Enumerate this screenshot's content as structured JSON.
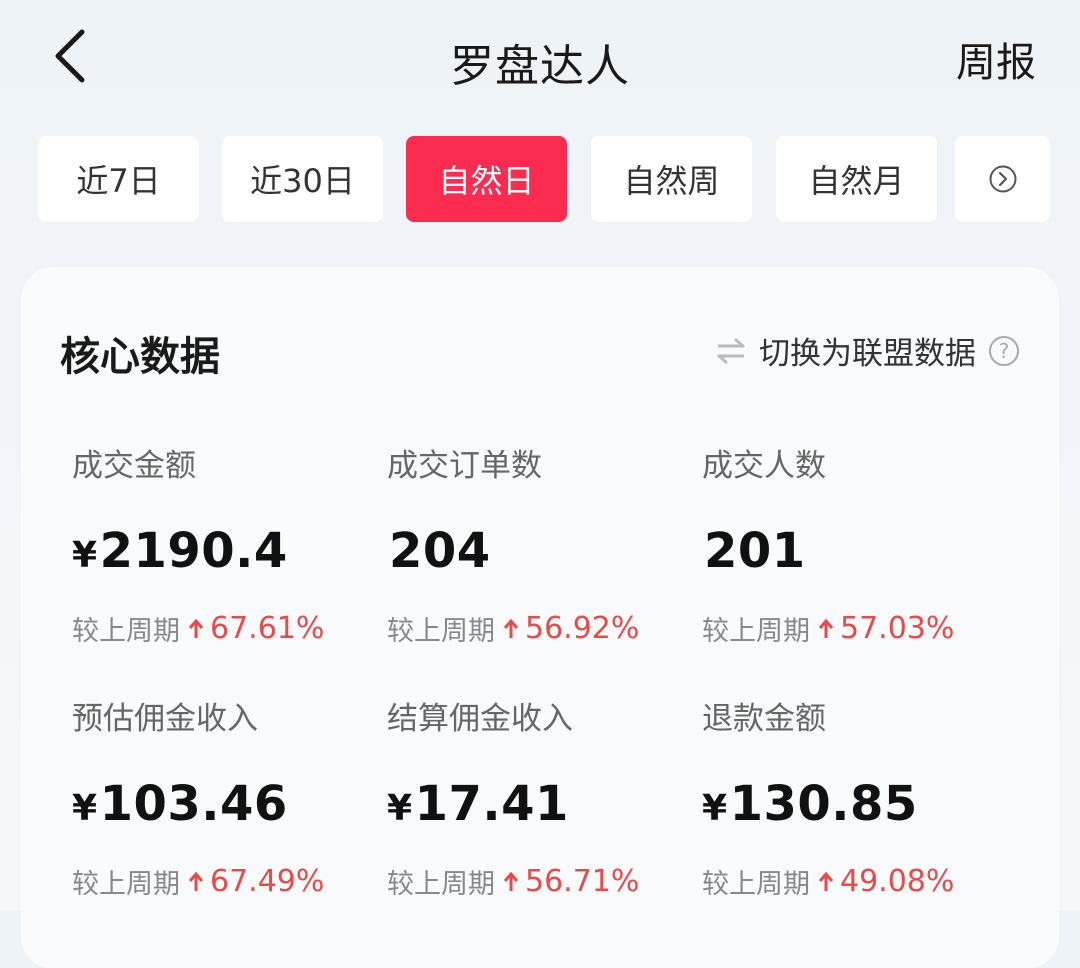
{
  "header": {
    "title": "罗盘达人",
    "right_label": "周报"
  },
  "tabs": [
    {
      "label": "近7日",
      "active": false
    },
    {
      "label": "近30日",
      "active": false
    },
    {
      "label": "自然日",
      "active": true
    },
    {
      "label": "自然周",
      "active": false
    },
    {
      "label": "自然月",
      "active": false
    }
  ],
  "colors": {
    "accent": "#fb2c4f",
    "increase": "#e84a4a"
  },
  "core": {
    "title": "核心数据",
    "switch_label": "切换为联盟数据",
    "metrics": [
      {
        "label": "成交金额",
        "currency": "¥",
        "value": "2190.4",
        "compare_label": "较上周期",
        "change": "67.61%"
      },
      {
        "label": "成交订单数",
        "currency": "",
        "value": "204",
        "compare_label": "较上周期",
        "change": "56.92%"
      },
      {
        "label": "成交人数",
        "currency": "",
        "value": "201",
        "compare_label": "较上周期",
        "change": "57.03%"
      },
      {
        "label": "预估佣金收入",
        "currency": "¥",
        "value": "103.46",
        "compare_label": "较上周期",
        "change": "67.49%"
      },
      {
        "label": "结算佣金收入",
        "currency": "¥",
        "value": "17.41",
        "compare_label": "较上周期",
        "change": "56.71%"
      },
      {
        "label": "退款金额",
        "currency": "¥",
        "value": "130.85",
        "compare_label": "较上周期",
        "change": "49.08%"
      }
    ]
  }
}
